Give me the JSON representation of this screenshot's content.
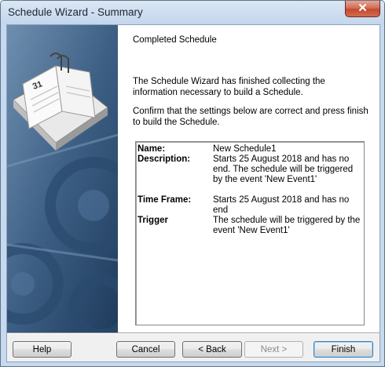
{
  "window": {
    "title": "Schedule Wizard - Summary",
    "close_label": "✕"
  },
  "page": {
    "heading": "Completed Schedule",
    "intro_text": "The Schedule Wizard has finished collecting the information necessary to build a Schedule.",
    "confirm_text": "Confirm that the settings below are correct and press finish to build the Schedule."
  },
  "summary": [
    {
      "label": "Name:",
      "value": "New Schedule1"
    },
    {
      "label": "Description:",
      "value": "Starts 25 August 2018 and has no end. The schedule will be triggered by the event 'New Event1'"
    },
    {
      "label": "Time Frame:",
      "value": "Starts 25 August 2018 and has no end"
    },
    {
      "label": "Trigger",
      "value": "The schedule will be triggered by the event 'New Event1'"
    }
  ],
  "art": {
    "calendar_day": "31"
  },
  "buttons": {
    "help": "Help",
    "cancel": "Cancel",
    "back": "< Back",
    "next": "Next >",
    "finish": "Finish"
  }
}
